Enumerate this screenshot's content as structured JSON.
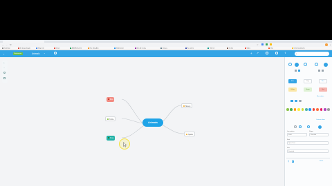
{
  "browser": {
    "url": "https://www.mindmeister.com/1057472960",
    "bookmarks": [
      {
        "label": "Tài khoản",
        "color": "#888888"
      },
      {
        "label": "Sử dụng Google",
        "color": "#db4437"
      },
      {
        "label": "Nhập mới",
        "color": "#4285f4"
      },
      {
        "label": "Gmail",
        "color": "#ea4335"
      },
      {
        "label": "ASEAN Summit",
        "color": "#0f9d58"
      },
      {
        "label": "Học tiếng Anh",
        "color": "#ff9800"
      },
      {
        "label": "Mindmeister",
        "color": "#2196f3"
      },
      {
        "label": "Bản đồ tư duy",
        "color": "#9c27b0"
      },
      {
        "label": "Công cụ",
        "color": "#607d8b"
      },
      {
        "label": "Học online",
        "color": "#3f51b5"
      },
      {
        "label": "Thiết kế",
        "color": "#009688"
      },
      {
        "label": "Tài liệu",
        "color": "#795548"
      },
      {
        "label": "Video",
        "color": "#f44336"
      },
      {
        "label": "Khác",
        "color": "#ff5722"
      },
      {
        "label": "Other bookmarks",
        "color": "#ffc107"
      }
    ]
  },
  "app": {
    "badge": "Mindmeister",
    "map_title": "Animals",
    "accent": "#33a4e5"
  },
  "mindmap": {
    "center": "Animals",
    "nodes": [
      {
        "id": "bird",
        "label": "Bird",
        "bg": "#f28b82",
        "fg": "#ffffff"
      },
      {
        "id": "turtle",
        "label": "Turtle",
        "bg": "#ffffff",
        "fg": "#555555"
      },
      {
        "id": "frog",
        "label": "Frog",
        "bg": "#20b1a6",
        "fg": "#ffffff"
      },
      {
        "id": "sheep",
        "label": "Sheep",
        "bg": "#ffffff",
        "fg": "#555555"
      },
      {
        "id": "spider",
        "label": "Spider",
        "bg": "#ffffff",
        "fg": "#555555"
      }
    ]
  },
  "panel": {
    "style_presets": [
      "Blue",
      "Grey",
      "Blue",
      "Yellow",
      "Green",
      "Red"
    ],
    "color_swatches": [
      "#8bc34a",
      "#4caf50",
      "#ff9800",
      "#ffeb3b",
      "#cddc39",
      "#4db6ac",
      "#2196f3",
      "#f44336",
      "#ff7043",
      "#e91e63",
      "#ab47bc",
      "#9e9e9e"
    ],
    "labels": {
      "more": "More styles",
      "custom": "Custom colors",
      "border_label": "Line pattern",
      "border_value": "Solid",
      "shape_label": "Shape",
      "shape_value": "Rounded",
      "font_label": "Font",
      "font_value": "Open Sans",
      "size_label": "Size",
      "size_value": "Standard",
      "footer": "Reset"
    }
  }
}
